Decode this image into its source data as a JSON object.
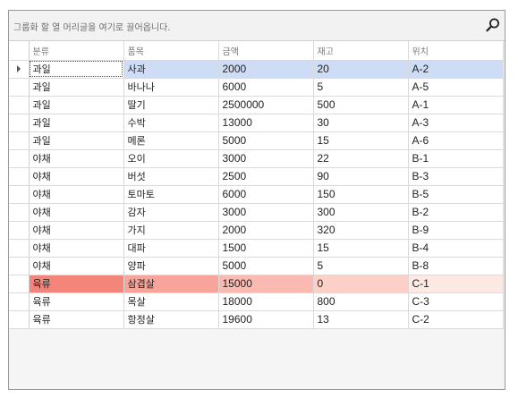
{
  "group_panel": {
    "hint": "그룹화 할 열 머리글을 여기로 끌어옵니다.",
    "find_icon": "search-icon"
  },
  "columns": [
    "분류",
    "품목",
    "금액",
    "재고",
    "위치"
  ],
  "rows": [
    [
      "과일",
      "사과",
      "2000",
      "20",
      "A-2"
    ],
    [
      "과일",
      "바나나",
      "6000",
      "5",
      "A-5"
    ],
    [
      "과일",
      "딸기",
      "2500000",
      "500",
      "A-1"
    ],
    [
      "과일",
      "수박",
      "13000",
      "30",
      "A-3"
    ],
    [
      "과일",
      "메론",
      "5000",
      "15",
      "A-6"
    ],
    [
      "야채",
      "오이",
      "3000",
      "22",
      "B-1"
    ],
    [
      "야채",
      "버섯",
      "2500",
      "90",
      "B-3"
    ],
    [
      "야채",
      "토마토",
      "6000",
      "150",
      "B-5"
    ],
    [
      "야채",
      "감자",
      "3000",
      "300",
      "B-2"
    ],
    [
      "야채",
      "가지",
      "2000",
      "320",
      "B-9"
    ],
    [
      "야채",
      "대파",
      "1500",
      "15",
      "B-4"
    ],
    [
      "야채",
      "양파",
      "5000",
      "5",
      "B-8"
    ],
    [
      "육류",
      "삼겹살",
      "15000",
      "0",
      "C-1"
    ],
    [
      "육류",
      "목살",
      "18000",
      "800",
      "C-3"
    ],
    [
      "육류",
      "항정살",
      "19600",
      "13",
      "C-2"
    ]
  ],
  "focused_row": 0,
  "alert_row": 12,
  "colors": {
    "focused_row": "#cfdcf5",
    "alert_start": "#f4857b",
    "alert_end": "#fde9e3"
  }
}
